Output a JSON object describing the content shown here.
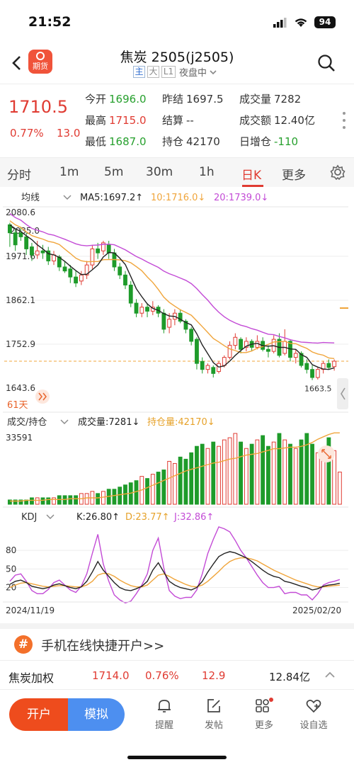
{
  "status": {
    "time": "21:52",
    "battery": "94"
  },
  "header": {
    "title": "焦炭 2505(j2505)",
    "logo_text": "期货",
    "tag_main": "主",
    "tag_big": "大",
    "tag_l1": "L1",
    "session": "夜盘中"
  },
  "quote": {
    "price": "1710.5",
    "pct": "0.77%",
    "change": "13.0",
    "rows": [
      [
        {
          "label": "今开",
          "value": "1696.0",
          "color": "green"
        },
        {
          "label": "昨结",
          "value": "1697.5",
          "color": "black"
        },
        {
          "label": "成交量",
          "value": "7282",
          "color": "black"
        }
      ],
      [
        {
          "label": "最高",
          "value": "1715.0",
          "color": "red"
        },
        {
          "label": "结算",
          "value": "--",
          "color": "black"
        },
        {
          "label": "成交额",
          "value": "12.40亿",
          "color": "black"
        }
      ],
      [
        {
          "label": "最低",
          "value": "1687.0",
          "color": "green"
        },
        {
          "label": "持仓",
          "value": "42170",
          "color": "black"
        },
        {
          "label": "日增仓",
          "value": "-110",
          "color": "green"
        }
      ]
    ]
  },
  "tabs": {
    "items": [
      "分时",
      "1m",
      "5m",
      "30m",
      "1h",
      "日K",
      "更多"
    ],
    "active": "日K"
  },
  "kline": {
    "indicator_label": "均线",
    "ma5": "MA5:1697.2↑",
    "ma10": "10:1716.0↓",
    "ma20": "20:1739.0↓",
    "axis_top": "2080.6",
    "axis_2": "2035.0",
    "axis_3": "1971.6",
    "axis_4": "1862.1",
    "axis_5": "1752.9",
    "axis_bottom": "1643.6",
    "low_label": "1663.5",
    "days": "61天",
    "colors": {
      "up": "#e03b32",
      "down": "#1e9b2a",
      "ma5": "#222222",
      "ma10": "#f0a53b",
      "ma20": "#c34bd6"
    },
    "candles": [
      [
        2030,
        2050,
        2055,
        1995,
        0
      ],
      [
        2000,
        2030,
        2040,
        1985,
        0
      ],
      [
        2030,
        2020,
        2045,
        2010,
        0
      ],
      [
        2020,
        1990,
        2030,
        1975,
        0
      ],
      [
        1995,
        1975,
        2005,
        1960,
        0
      ],
      [
        1975,
        1985,
        2010,
        1965,
        1
      ],
      [
        1985,
        1980,
        2000,
        1965,
        0
      ],
      [
        1985,
        1960,
        1995,
        1950,
        0
      ],
      [
        1960,
        1975,
        1985,
        1950,
        1
      ],
      [
        1970,
        1945,
        1975,
        1935,
        0
      ],
      [
        1945,
        1935,
        1960,
        1930,
        0
      ],
      [
        1940,
        1920,
        1950,
        1905,
        0
      ],
      [
        1920,
        1905,
        1935,
        1895,
        0
      ],
      [
        1910,
        1925,
        1935,
        1900,
        1
      ],
      [
        1925,
        1950,
        1960,
        1915,
        1
      ],
      [
        1950,
        1990,
        2000,
        1940,
        1
      ],
      [
        1990,
        1980,
        2005,
        1965,
        0
      ],
      [
        1985,
        2005,
        2010,
        1975,
        1
      ],
      [
        2000,
        1980,
        2010,
        1965,
        0
      ],
      [
        1980,
        1945,
        1990,
        1935,
        0
      ],
      [
        1945,
        1925,
        1955,
        1915,
        0
      ],
      [
        1925,
        1900,
        1935,
        1890,
        0
      ],
      [
        1900,
        1855,
        1910,
        1845,
        0
      ],
      [
        1855,
        1830,
        1865,
        1820,
        0
      ],
      [
        1830,
        1845,
        1855,
        1820,
        1
      ],
      [
        1845,
        1835,
        1855,
        1820,
        0
      ],
      [
        1835,
        1845,
        1860,
        1825,
        1
      ],
      [
        1845,
        1830,
        1850,
        1820,
        0
      ],
      [
        1830,
        1790,
        1840,
        1780,
        0
      ],
      [
        1795,
        1815,
        1830,
        1780,
        1
      ],
      [
        1815,
        1830,
        1840,
        1800,
        1
      ],
      [
        1830,
        1810,
        1840,
        1805,
        0
      ],
      [
        1810,
        1790,
        1815,
        1780,
        0
      ],
      [
        1790,
        1760,
        1795,
        1750,
        0
      ],
      [
        1765,
        1705,
        1770,
        1690,
        0
      ],
      [
        1710,
        1690,
        1720,
        1680,
        0
      ],
      [
        1690,
        1700,
        1705,
        1680,
        1
      ],
      [
        1695,
        1680,
        1700,
        1670,
        0
      ],
      [
        1685,
        1705,
        1710,
        1680,
        1
      ],
      [
        1700,
        1720,
        1725,
        1695,
        1
      ],
      [
        1720,
        1750,
        1760,
        1715,
        1
      ],
      [
        1750,
        1770,
        1780,
        1740,
        1
      ],
      [
        1765,
        1740,
        1770,
        1730,
        0
      ],
      [
        1745,
        1760,
        1770,
        1735,
        1
      ],
      [
        1760,
        1745,
        1765,
        1735,
        0
      ],
      [
        1745,
        1760,
        1775,
        1740,
        1
      ],
      [
        1760,
        1740,
        1770,
        1735,
        0
      ],
      [
        1740,
        1735,
        1750,
        1720,
        0
      ],
      [
        1735,
        1765,
        1775,
        1730,
        1
      ],
      [
        1765,
        1725,
        1780,
        1720,
        0
      ],
      [
        1730,
        1760,
        1790,
        1725,
        1
      ],
      [
        1760,
        1720,
        1765,
        1710,
        0
      ],
      [
        1720,
        1730,
        1740,
        1705,
        1
      ],
      [
        1730,
        1700,
        1735,
        1695,
        0
      ],
      [
        1705,
        1690,
        1715,
        1680,
        0
      ],
      [
        1690,
        1670,
        1700,
        1663.5,
        0
      ],
      [
        1670,
        1690,
        1695,
        1665,
        1
      ],
      [
        1690,
        1705,
        1710,
        1680,
        1
      ],
      [
        1705,
        1695,
        1715,
        1690,
        0
      ],
      [
        1697,
        1710.5,
        1715,
        1687,
        1
      ]
    ]
  },
  "volume": {
    "indicator_label": "成交/持仓",
    "vol_text": "成交量:7281↓",
    "oi_text": "持仓量:42170↓",
    "axis_top": "33591",
    "values": [
      2,
      2,
      2,
      2,
      3,
      3,
      3,
      3,
      3,
      4,
      4,
      4,
      4,
      5,
      5,
      6,
      5,
      6,
      7,
      7,
      8,
      9,
      10,
      11,
      13,
      12,
      14,
      15,
      16,
      20,
      19,
      22,
      21,
      24,
      27,
      28,
      26,
      29,
      27,
      30,
      31,
      33,
      29,
      26,
      28,
      30,
      32,
      27,
      29,
      33,
      30,
      28,
      26,
      30,
      33,
      28,
      24,
      26,
      31,
      25,
      15
    ],
    "open_interest": [
      4,
      4,
      4,
      5,
      5,
      5,
      5,
      6,
      6,
      6,
      6,
      7,
      7,
      7,
      8,
      8,
      8,
      9,
      10,
      11,
      12,
      13,
      14,
      16,
      18,
      21,
      24,
      27,
      30,
      33,
      36,
      39,
      42,
      44,
      46,
      48,
      50,
      52,
      53,
      55,
      57,
      58,
      60,
      62,
      63,
      64,
      66,
      68,
      70,
      70,
      71,
      72,
      72,
      73,
      75,
      78,
      82,
      85,
      88,
      90,
      90
    ]
  },
  "kdj": {
    "indicator_label": "KDJ",
    "k_text": "K:26.80↑",
    "d_text": "D:23.77↑",
    "j_text": "J:32.86↑",
    "axis_80": "80",
    "axis_50": "50",
    "axis_20": "20",
    "date_start": "2024/11/19",
    "date_end": "2025/02/20",
    "k": [
      25,
      30,
      32,
      28,
      22,
      20,
      18,
      20,
      24,
      26,
      23,
      20,
      18,
      21,
      30,
      45,
      62,
      48,
      38,
      28,
      20,
      16,
      15,
      18,
      22,
      30,
      48,
      60,
      45,
      30,
      24,
      20,
      18,
      16,
      20,
      30,
      45,
      58,
      70,
      75,
      78,
      76,
      72,
      68,
      62,
      55,
      48,
      42,
      38,
      36,
      30,
      28,
      25,
      22,
      20,
      16,
      18,
      22,
      24,
      25,
      26.8
    ],
    "d": [
      20,
      24,
      27,
      28,
      26,
      24,
      22,
      21,
      22,
      23,
      23,
      22,
      21,
      21,
      24,
      30,
      40,
      43,
      42,
      38,
      32,
      27,
      23,
      21,
      21,
      24,
      32,
      40,
      42,
      38,
      33,
      29,
      25,
      22,
      21,
      24,
      30,
      38,
      46,
      55,
      62,
      66,
      68,
      68,
      66,
      63,
      58,
      53,
      48,
      44,
      40,
      36,
      32,
      29,
      26,
      23,
      21,
      21,
      22,
      23,
      23.77
    ],
    "j": [
      30,
      40,
      42,
      30,
      15,
      10,
      10,
      17,
      28,
      32,
      24,
      16,
      12,
      22,
      42,
      75,
      106,
      58,
      30,
      8,
      0,
      -5,
      -2,
      10,
      24,
      42,
      80,
      100,
      52,
      15,
      6,
      2,
      4,
      4,
      16,
      42,
      75,
      98,
      118,
      115,
      110,
      96,
      80,
      68,
      54,
      40,
      28,
      20,
      20,
      22,
      10,
      12,
      12,
      8,
      8,
      0,
      10,
      24,
      28,
      30,
      32.86
    ]
  },
  "promo": {
    "text": "手机在线快捷开户>>"
  },
  "ticker": {
    "name": "焦炭加权",
    "price": "1714.0",
    "pct": "0.76%",
    "change": "12.9",
    "amount": "12.84亿"
  },
  "bottom": {
    "open_label": "开户",
    "sim_label": "模拟",
    "nav": [
      {
        "label": "提醒",
        "icon": "bell-icon"
      },
      {
        "label": "发帖",
        "icon": "edit-icon"
      },
      {
        "label": "更多",
        "icon": "grid-icon"
      },
      {
        "label": "设自选",
        "icon": "heart-add-icon"
      }
    ]
  }
}
